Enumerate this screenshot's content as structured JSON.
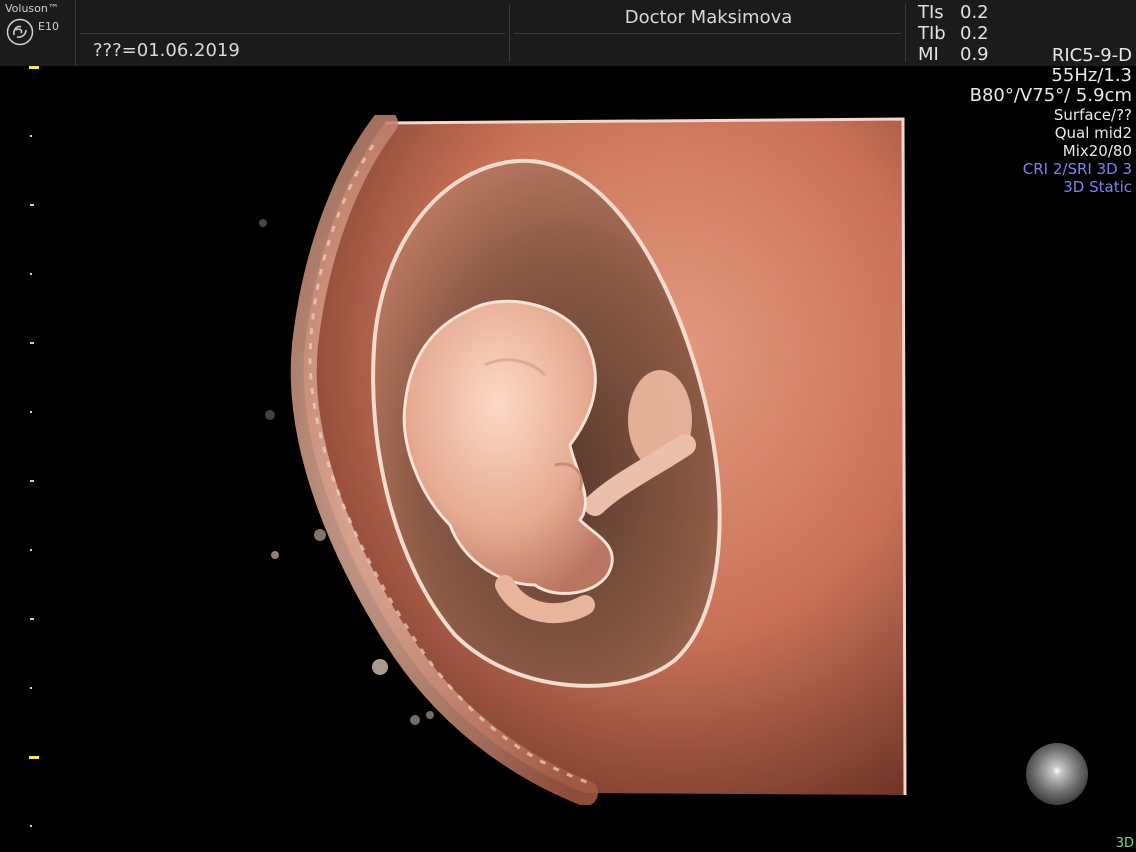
{
  "header": {
    "brand": "Voluson™",
    "model": "E10",
    "date_text": "???=01.06.2019",
    "doctor": "Doctor Maksimova",
    "params": [
      {
        "label": "TIs",
        "value": "0.2"
      },
      {
        "label": "TIb",
        "value": "0.2"
      },
      {
        "label": "MI",
        "value": "0.9"
      }
    ]
  },
  "info": {
    "probe": "RIC5-9-D",
    "frequency": "55Hz/1.3",
    "geometry": "B80°/V75°/ 5.9cm",
    "render_mode": "Surface/??",
    "quality": "Qual mid2",
    "mix": "Mix20/80",
    "cri": "CRI 2/SRI 3D 3",
    "acquisition": "3D Static"
  },
  "mode_tag": "3D",
  "colors": {
    "background": "#000000",
    "header_bg": "#1b1b1b",
    "tissue": "#d9826a",
    "highlight_blue": "#7d82f2",
    "mode_green": "#79d67a"
  },
  "icons": [
    "ge-logo-icon",
    "render-light-orb-icon"
  ]
}
